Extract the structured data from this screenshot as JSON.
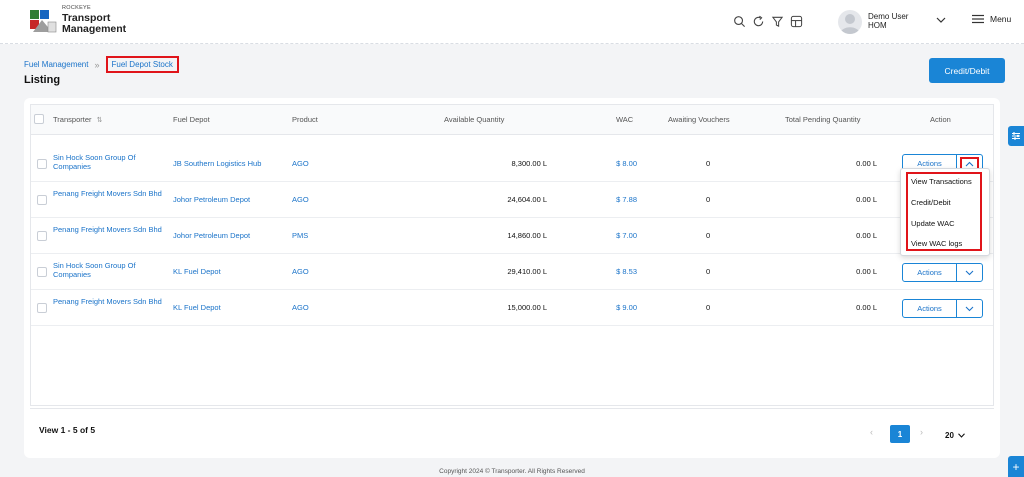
{
  "brand": {
    "line1": "ROCKEYE",
    "line2": "Transport",
    "line3": "Management"
  },
  "header": {
    "icons": [
      "search-icon",
      "refresh-icon",
      "filter-icon",
      "layout-icon"
    ],
    "user_name": "Demo User",
    "user_role": "HOM",
    "menu_label": "Menu"
  },
  "breadcrumb": {
    "parent": "Fuel Management",
    "current": "Fuel Depot Stock"
  },
  "page": {
    "title": "Listing",
    "credit_debit_label": "Credit/Debit"
  },
  "table": {
    "columns": [
      "Transporter",
      "Fuel Depot",
      "Product",
      "Available Quantity",
      "WAC",
      "Awaiting Vouchers",
      "Total Pending Quantity",
      "Action"
    ],
    "rows": [
      {
        "transporter": "Sin Hock Soon Group Of Companies",
        "depot": "JB Southern Logistics Hub",
        "product": "AGO",
        "available": "8,300.00 L",
        "wac": "$ 8.00",
        "awaiting": "0",
        "pending": "0.00 L",
        "action": "Actions"
      },
      {
        "transporter": "Penang Freight Movers Sdn Bhd",
        "depot": "Johor Petroleum Depot",
        "product": "AGO",
        "available": "24,604.00 L",
        "wac": "$ 7.88",
        "awaiting": "0",
        "pending": "0.00 L",
        "action": "Actions"
      },
      {
        "transporter": "Penang Freight Movers Sdn Bhd",
        "depot": "Johor Petroleum Depot",
        "product": "PMS",
        "available": "14,860.00 L",
        "wac": "$ 7.00",
        "awaiting": "0",
        "pending": "0.00 L",
        "action": "Actions"
      },
      {
        "transporter": "Sin Hock Soon Group Of Companies",
        "depot": "KL Fuel Depot",
        "product": "AGO",
        "available": "29,410.00 L",
        "wac": "$ 8.53",
        "awaiting": "0",
        "pending": "0.00 L",
        "action": "Actions"
      },
      {
        "transporter": "Penang Freight Movers Sdn Bhd",
        "depot": "KL Fuel Depot",
        "product": "AGO",
        "available": "15,000.00 L",
        "wac": "$ 9.00",
        "awaiting": "0",
        "pending": "0.00 L",
        "action": "Actions"
      }
    ]
  },
  "action_menu": [
    "View Transactions",
    "Credit/Debit",
    "Update WAC",
    "View WAC logs"
  ],
  "pagination": {
    "summary": "View 1 - 5 of 5",
    "current_page": "1",
    "page_size": "20"
  },
  "footer": {
    "copyright": "Copyright 2024 © Transporter. All Rights Reserved"
  },
  "colors": {
    "accent": "#1a85d6",
    "link": "#1a73c9",
    "highlight": "#e0141a"
  }
}
